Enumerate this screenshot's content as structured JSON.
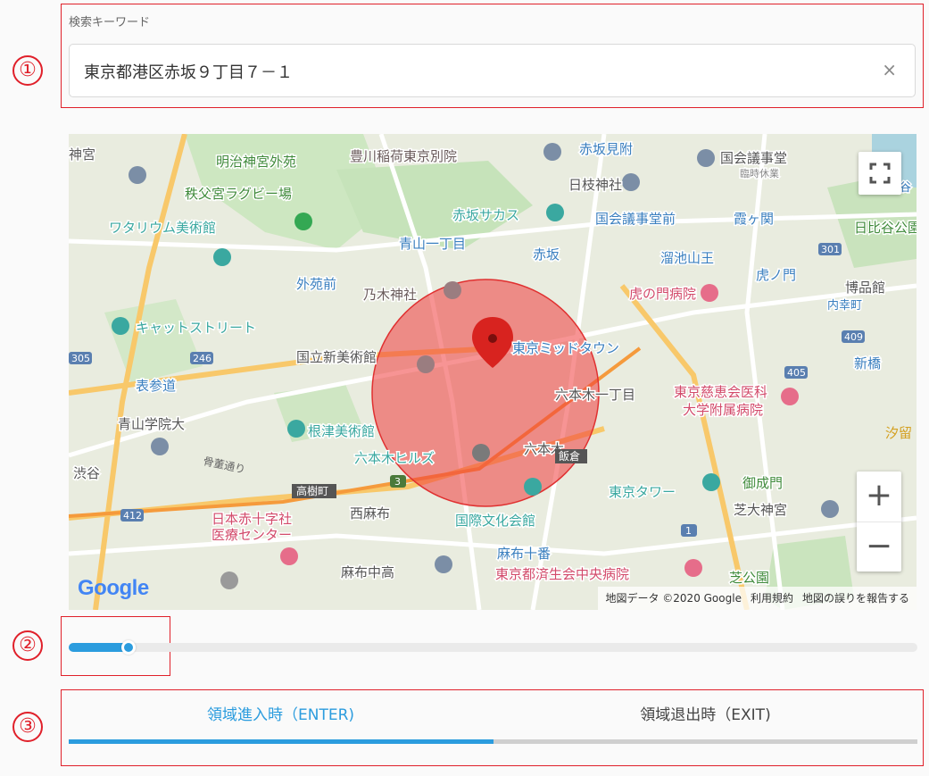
{
  "annotations": {
    "one": "①",
    "two": "②",
    "three": "③"
  },
  "search": {
    "label": "検索キーワード",
    "value": "東京都港区赤坂９丁目７－１",
    "clear_symbol": "×"
  },
  "map": {
    "place_labels": [
      "神宮",
      "明治神宮外苑",
      "豊川稲荷東京別院",
      "赤坂見附",
      "国会議事堂",
      "臨時休業",
      "秩父宮ラグビー場",
      "日枝神社",
      "日比谷",
      "ワタリウム美術館",
      "赤坂サカス",
      "国会議事堂前",
      "霞ヶ関",
      "日比谷公園",
      "青山一丁目",
      "赤坂",
      "溜池山王",
      "外苑前",
      "乃木神社",
      "虎の門病院",
      "虎ノ門",
      "博品館",
      "内幸町",
      "キャットストリート",
      "国立新美術館",
      "東京ミッドタウン",
      "六本木一丁目",
      "新橋",
      "表参道",
      "東京慈恵会医科",
      "大学附属病院",
      "青山学院大",
      "根津美術館",
      "六本木",
      "渋谷",
      "六本木ヒルズ",
      "御成門",
      "東京タワー",
      "日本赤十字社",
      "医療センター",
      "西麻布",
      "国際文化会館",
      "芝大神宮",
      "麻布十番",
      "麻布中高",
      "東京都済生会中央病院",
      "芝公園",
      "246",
      "305",
      "412",
      "409",
      "405",
      "301",
      "3",
      "1",
      "骨董通り",
      "高樹町",
      "飯倉",
      "汐留"
    ],
    "google_logo": "Google",
    "attribution": {
      "data": "地図データ ©2020 Google",
      "terms": "利用規約",
      "report": "地図の誤りを報告する"
    },
    "zoom_in": "+",
    "zoom_out": "−"
  },
  "slider": {
    "value_fraction": 0.07
  },
  "tabs": {
    "enter_label": "領域進入時（ENTER)",
    "exit_label": "領域退出時（EXIT)",
    "active": "enter"
  },
  "colors": {
    "accent": "#2b9cde",
    "annotation": "#e0202a",
    "circle": "#f04040"
  }
}
